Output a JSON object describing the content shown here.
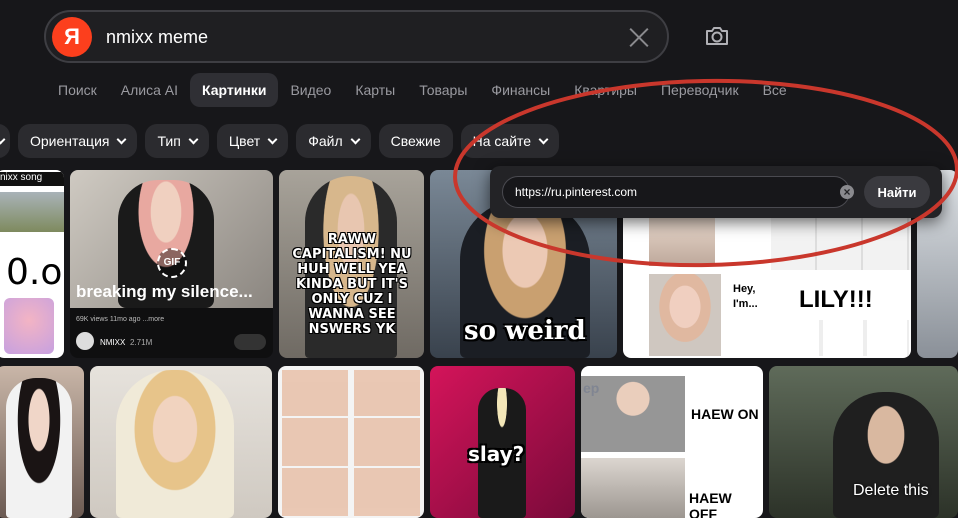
{
  "search": {
    "logo_letter": "Я",
    "query": "nmixx meme"
  },
  "tabs": [
    {
      "label": "Поиск",
      "active": false
    },
    {
      "label": "Алиса AI",
      "active": false
    },
    {
      "label": "Картинки",
      "active": true
    },
    {
      "label": "Видео",
      "active": false
    },
    {
      "label": "Карты",
      "active": false
    },
    {
      "label": "Товары",
      "active": false
    },
    {
      "label": "Финансы",
      "active": false
    },
    {
      "label": "Квартиры",
      "active": false
    },
    {
      "label": "Переводчик",
      "active": false
    },
    {
      "label": "Все",
      "active": false
    }
  ],
  "filters": [
    "Ориентация",
    "Тип",
    "Цвет",
    "Файл",
    "Свежие",
    "На сайте"
  ],
  "site_popup": {
    "url_value": "https://ru.pinterest.com",
    "find_label": "Найти"
  },
  "tiles": {
    "t1_caption": "nixx song",
    "t1_big": "0.o",
    "t2_title": "breaking my silence...",
    "t2_gif": "GIF",
    "t2_meta": "69K views  11mo ago  ...more",
    "t2_channel": "NMIXX",
    "t2_subs": "2.71M",
    "t3_text": "RAWW CAPITALISM! NU HUH WELL YEA KINDA BUT IT'S ONLY CUZ I WANNA SEE NSWERS YK",
    "t4_text": "so weird",
    "t5_hey": "Hey, I'm...",
    "t5_lily": "LILY!!!",
    "t9_text": "slay?",
    "t10_top": "HAEW ON",
    "t10_bottom": "HAEW OFF",
    "t10_logo": "ep",
    "t11_text": "Delete this"
  },
  "colors": {
    "background": "#17171a",
    "brand_red": "#fc3f1d",
    "annotation": "#c9372c"
  },
  "icons": [
    "yandex-logo-icon",
    "clear-icon",
    "camera-search-icon",
    "chevron-down-icon"
  ]
}
